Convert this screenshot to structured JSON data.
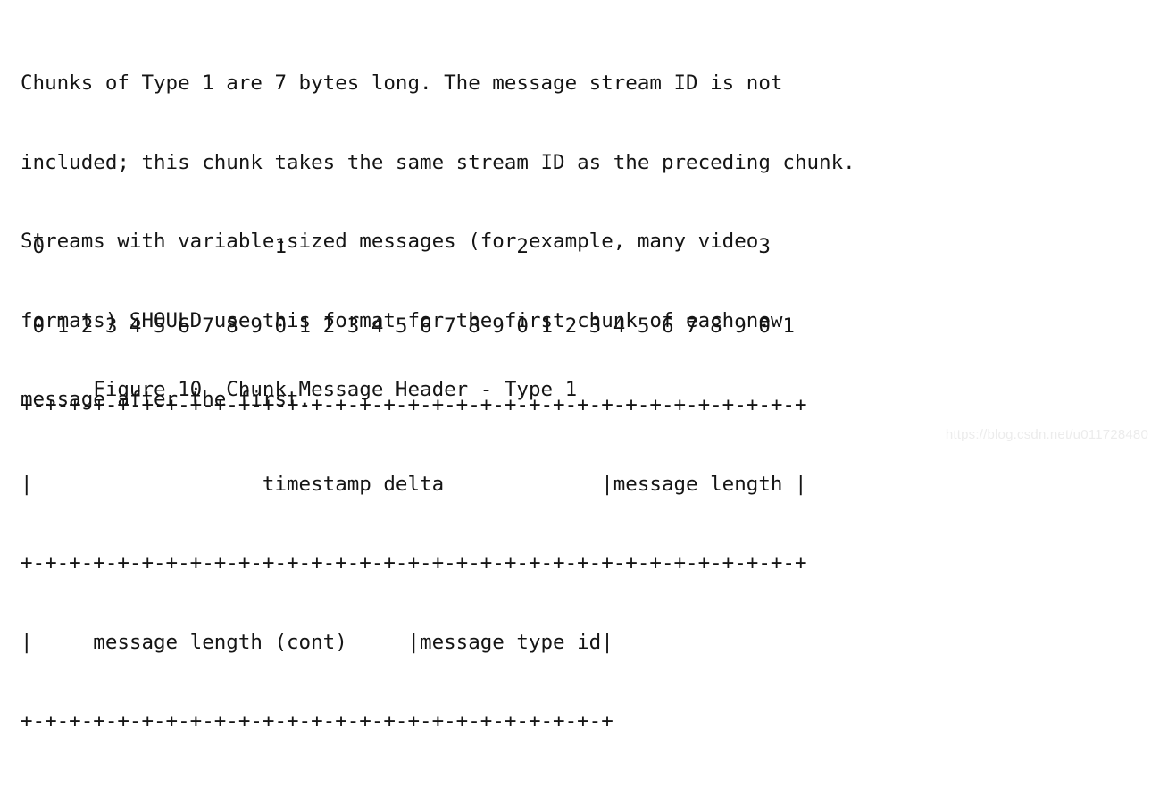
{
  "document": {
    "background_color": "#ffffff",
    "text_color": "#151515",
    "paragraph": {
      "lines": [
        "Chunks of Type 1 are 7 bytes long. The message stream ID is not",
        "included; this chunk takes the same stream ID as the preceding chunk.",
        "Streams with variable-sized messages (for example, many video",
        "formats) SHOULD use this format for the first chunk of each new",
        "message after the first."
      ],
      "full_text": "Chunks of Type 1 are 7 bytes long. The message stream ID is not included; this chunk takes the same stream ID as the preceding chunk. Streams with variable-sized messages (for example, many video formats) SHOULD use this format for the first chunk of each new message after the first."
    },
    "diagram": {
      "ruler_tens": " 0                   1                   2                   3",
      "ruler_units": " 0 1 2 3 4 5 6 7 8 9 0 1 2 3 4 5 6 7 8 9 0 1 2 3 4 5 6 7 8 9 0 1",
      "separator_full": "+-+-+-+-+-+-+-+-+-+-+-+-+-+-+-+-+-+-+-+-+-+-+-+-+-+-+-+-+-+-+-+-+",
      "separator_short": "+-+-+-+-+-+-+-+-+-+-+-+-+-+-+-+-+-+-+-+-+-+-+-+-+",
      "row1": "|                   timestamp delta             |message length |",
      "row2": "|     message length (cont)     |message type id|",
      "fields": [
        {
          "name": "timestamp delta",
          "bits": 24,
          "row": 1
        },
        {
          "name": "message length",
          "bits": 24,
          "row": 1
        },
        {
          "name": "message length (cont)",
          "bits": 16,
          "row": 2
        },
        {
          "name": "message type id",
          "bits": 8,
          "row": 2
        }
      ],
      "bit_width": 32,
      "total_bytes": 7
    },
    "caption": "      Figure 10  Chunk Message Header - Type 1",
    "caption_text": "Figure 10  Chunk Message Header - Type 1",
    "figure_number": "Figure 10",
    "figure_title": "Chunk Message Header - Type 1"
  },
  "watermark": {
    "text": "https://blog.csdn.net/u011728480",
    "color": "#ececec"
  }
}
